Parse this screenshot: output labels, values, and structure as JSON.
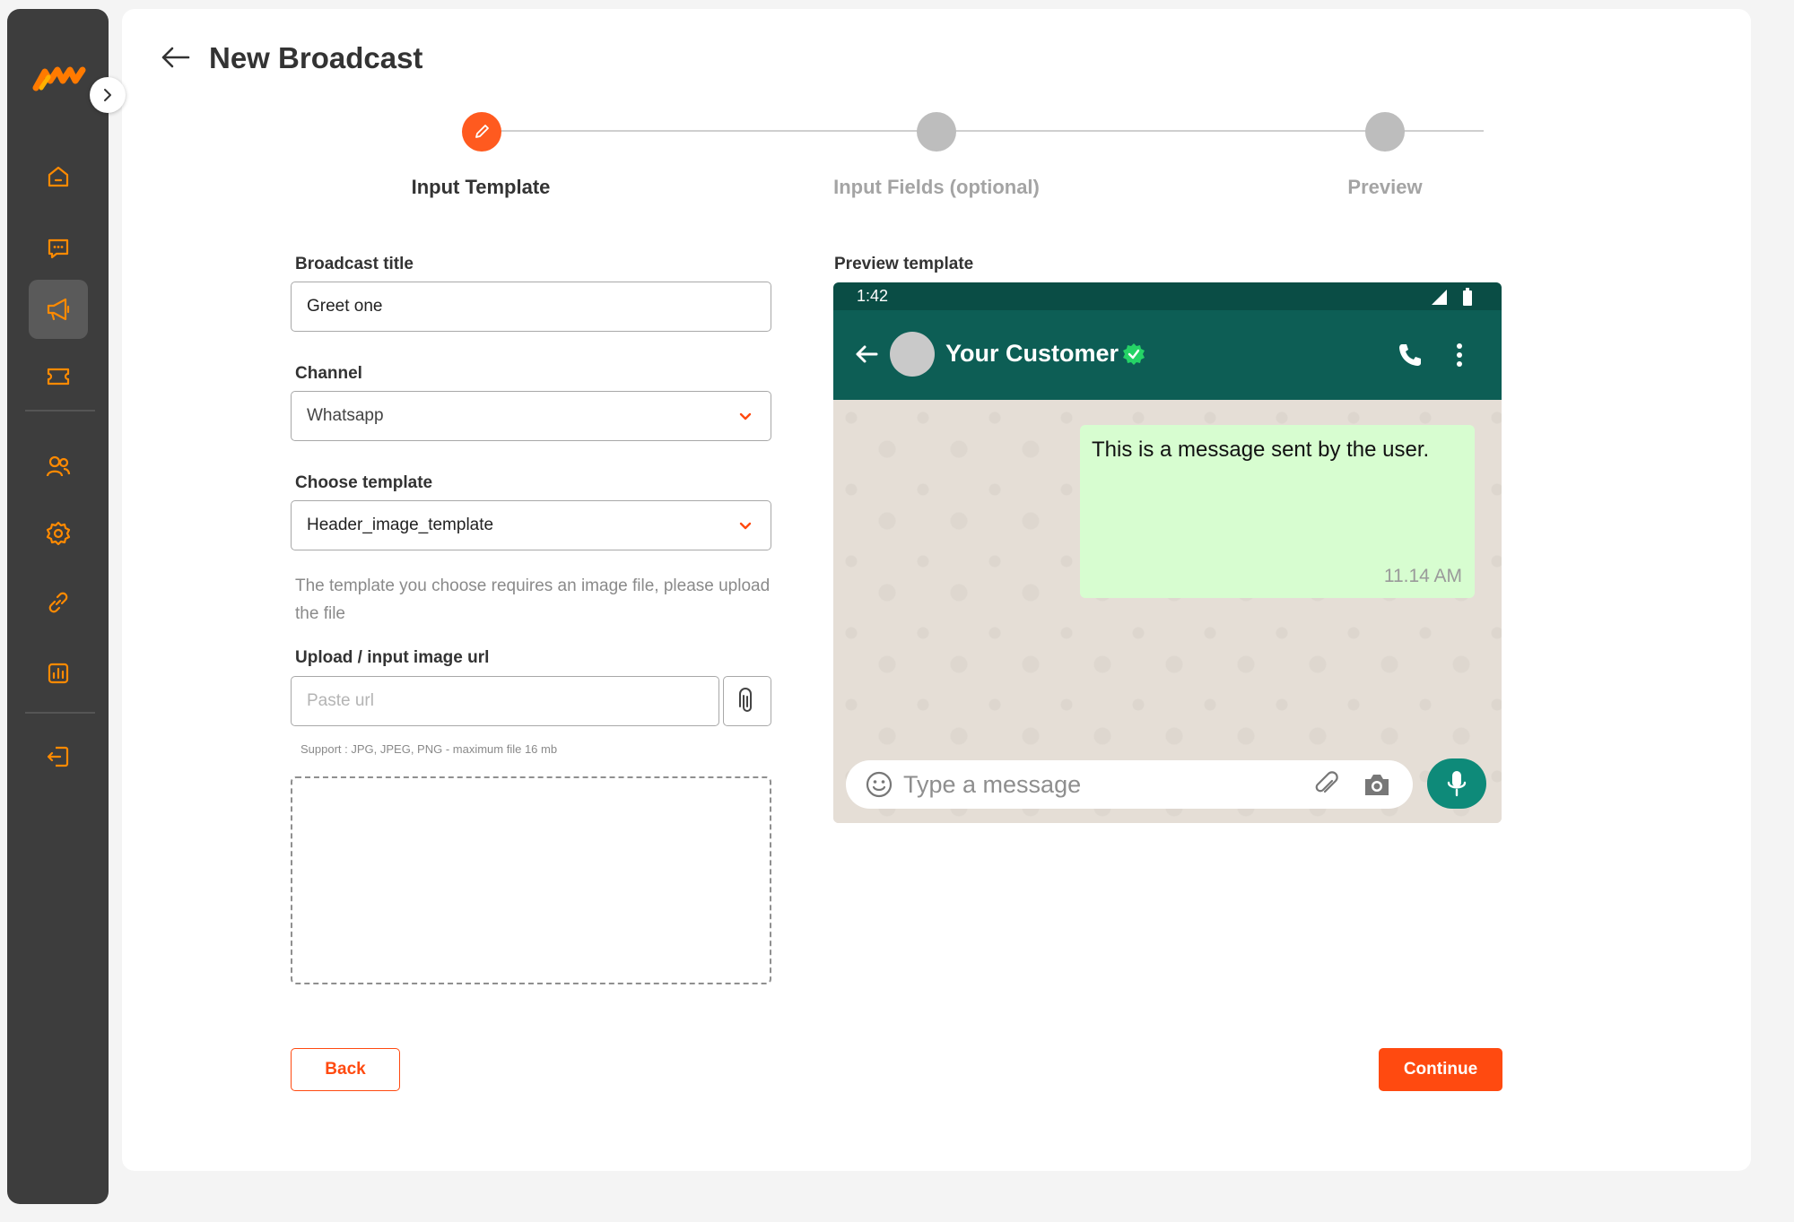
{
  "page": {
    "title": "New Broadcast"
  },
  "colors": {
    "accent": "#ff4a10",
    "sidebar": "#3d3d3d",
    "whatsapp_header": "#0d5e55",
    "bubble": "#d7fdd0"
  },
  "sidebar": {
    "items": [
      {
        "icon": "home-icon"
      },
      {
        "icon": "chat-icon"
      },
      {
        "icon": "megaphone-icon",
        "active": true
      },
      {
        "icon": "ticket-icon"
      },
      {
        "icon": "users-icon"
      },
      {
        "icon": "gear-icon"
      },
      {
        "icon": "link-icon"
      },
      {
        "icon": "chart-icon"
      },
      {
        "icon": "logout-icon"
      }
    ]
  },
  "stepper": {
    "steps": [
      {
        "label": "Input Template",
        "active": true
      },
      {
        "label": "Input Fields (optional)",
        "active": false
      },
      {
        "label": "Preview",
        "active": false
      }
    ]
  },
  "form": {
    "broadcast_title": {
      "label": "Broadcast title",
      "value": "Greet one"
    },
    "channel": {
      "label": "Channel",
      "value": "Whatsapp"
    },
    "template": {
      "label": "Choose template",
      "value": "Header_image_template"
    },
    "helper_text": "The template you choose requires an image file, please upload the file",
    "image_url": {
      "label": "Upload / input image url",
      "placeholder": "Paste url"
    },
    "support_text": "Support : JPG, JPEG, PNG - maximum file 16 mb"
  },
  "preview": {
    "label": "Preview template",
    "status_time": "1:42",
    "contact_name": "Your Customer",
    "message": "This is a message sent by the user.",
    "message_time": "11.14 AM",
    "input_placeholder": "Type a message"
  },
  "actions": {
    "back_label": "Back",
    "continue_label": "Continue"
  }
}
